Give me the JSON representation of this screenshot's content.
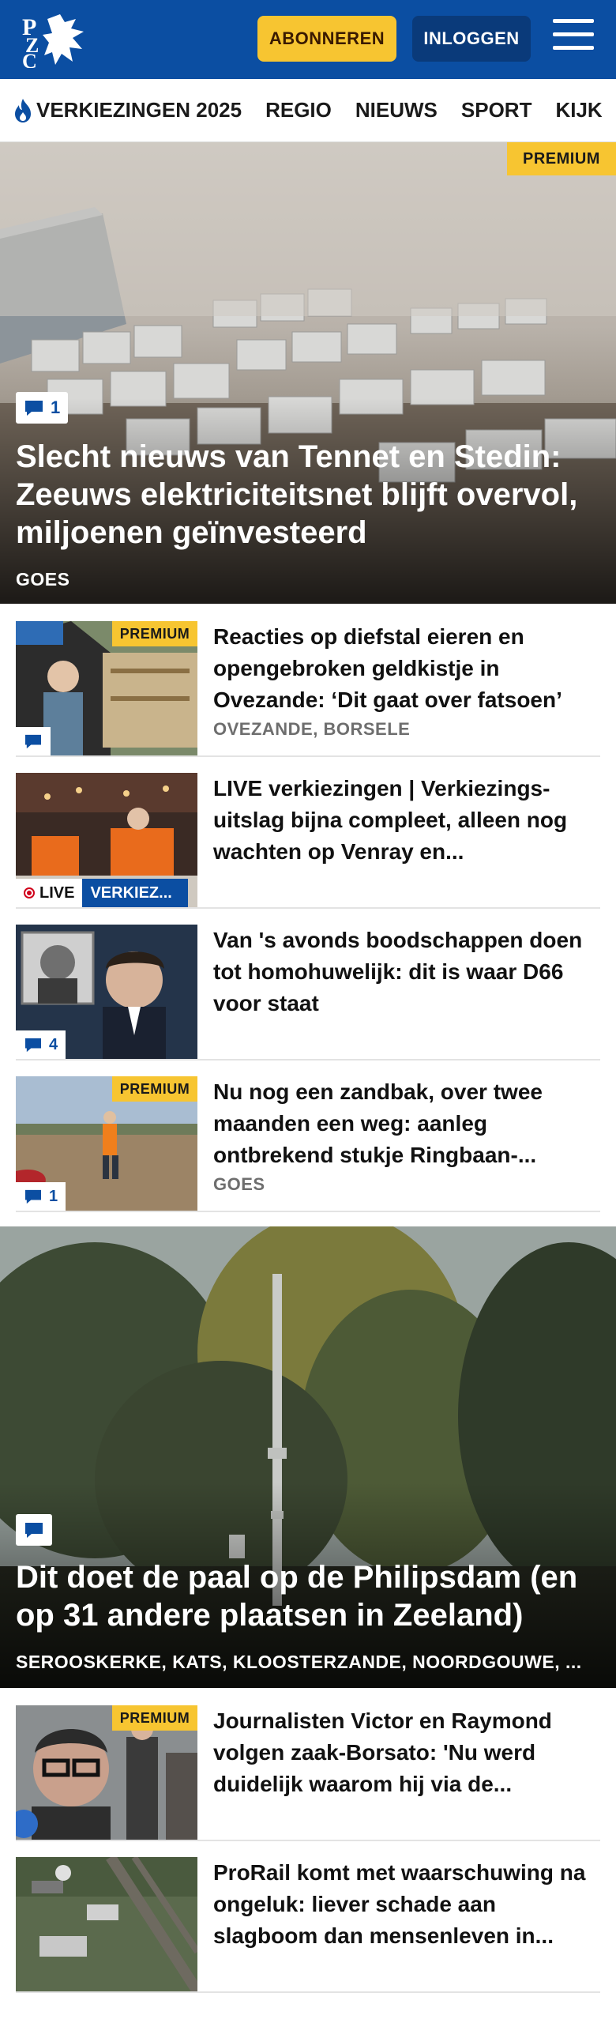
{
  "header": {
    "logo_text": "PZC",
    "subscribe_label": "ABONNEREN",
    "login_label": "INLOGGEN",
    "menu_icon": "hamburger-icon",
    "colors": {
      "brand": "#0b4ea2",
      "accent": "#f7c531"
    }
  },
  "nav": {
    "items": [
      {
        "label": "VERKIEZINGEN 2025",
        "icon": "flame-icon"
      },
      {
        "label": "REGIO"
      },
      {
        "label": "NIEUWS"
      },
      {
        "label": "SPORT"
      },
      {
        "label": "KIJK"
      }
    ]
  },
  "hero1": {
    "premium_label": "PREMIUM",
    "comment_count": "1",
    "title": "Slecht nieuws van Tennet en Stedin: Zeeuws elektriciteitsnet blijft overvol, miljoenen geïnvesteerd",
    "location": "GOES"
  },
  "articles": [
    {
      "premium_label": "PREMIUM",
      "comment_count": "",
      "title": "Reacties op diefstal eieren en opengebroken geldkistje in Ovezande: ‘Dit gaat over fatsoen’",
      "location": "OVEZANDE, BORSELE"
    },
    {
      "live_label": "LIVE",
      "category": "VERKIEZ...",
      "title": "LIVE verkiezingen | Verkiezings­uitslag bijna compleet, alleen nog wachten op Venray en..."
    },
    {
      "comment_count": "4",
      "title": "Van 's avonds boodschappen doen tot homohuwelijk: dit is waar D66 voor staat"
    },
    {
      "premium_label": "PREMIUM",
      "comment_count": "1",
      "title": "Nu nog een zandbak, over twee maanden een weg: aanleg ontbrekend stukje Ringbaan-...",
      "location": "GOES"
    }
  ],
  "hero2": {
    "comment_count": "",
    "title": "Dit doet de paal op de Philipsdam (en op 31 andere plaatsen in Zeeland)",
    "location": "SEROOSKERKE, KATS, KLOOSTERZANDE, NOORDGOUWE, ..."
  },
  "articles2": [
    {
      "premium_label": "PREMIUM",
      "title": "Journalisten Victor en Raymond volgen zaak-Borsato: 'Nu werd duidelijk waarom hij via de..."
    },
    {
      "title": "ProRail komt met waarschuwing na ongeluk: liever schade aan slagboom dan mensenleven in..."
    }
  ]
}
